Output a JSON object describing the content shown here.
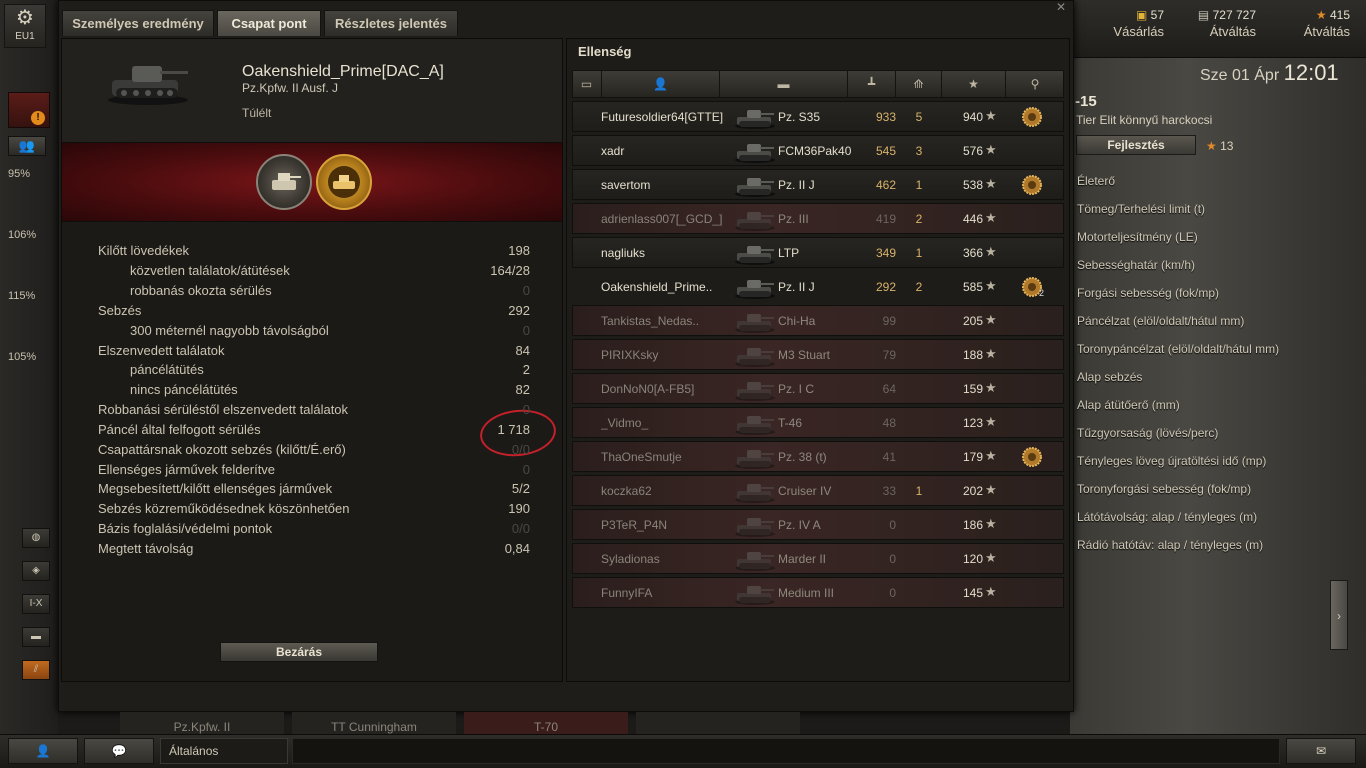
{
  "server": "EU1",
  "currency": [
    {
      "value": "57",
      "label": "Vásárlás"
    },
    {
      "value": "727 727",
      "label": "Átváltás"
    },
    {
      "value": "415",
      "label": "Átváltás"
    }
  ],
  "datetime": {
    "date": "Sze 01 Ápr",
    "time": "12:01"
  },
  "vehicle_panel": {
    "tier_num": "-15",
    "tier_desc": "Tier Elit könnyű harckocsi",
    "upgrade": "Fejlesztés",
    "xp": "13",
    "specs": [
      "Életerő",
      "Tömeg/Terhelési limit (t)",
      "Motorteljesítmény (LE)",
      "Sebességhatár (km/h)",
      "Forgási sebesség (fok/mp)",
      "Páncélzat (elöl/oldalt/hátul mm)",
      "Toronypáncélzat (elöl/oldalt/hátul mm)",
      "Alap sebzés",
      "Alap átütőerő (mm)",
      "Tűzgyorsaság (lövés/perc)",
      "Tényleges löveg újratöltési idő (mp)",
      "Toronyforgási sebesség (fok/mp)",
      "Látótávolság: alap / tényleges (m)",
      "Rádió hatótáv: alap / tényleges (m)"
    ]
  },
  "left_strip": {
    "percents": [
      "95%",
      "106%",
      "115%",
      "105%"
    ],
    "tier_btn": "I-X"
  },
  "tabs": [
    "Személyes eredmény",
    "Csapat pont",
    "Részletes jelentés"
  ],
  "player": {
    "name": "Oakenshield_Prime[DAC_A]",
    "vehicle": "Pz.Kpfw. II Ausf. J",
    "status": "Túlélt"
  },
  "stats": [
    {
      "label": "Kilőtt lövedékek",
      "value": "198",
      "indent": false,
      "dim": false
    },
    {
      "label": "közvetlen találatok/átütések",
      "value": "164/28",
      "indent": true,
      "dim": false
    },
    {
      "label": "robbanás okozta sérülés",
      "value": "0",
      "indent": true,
      "dim": true
    },
    {
      "label": "Sebzés",
      "value": "292",
      "indent": false,
      "dim": false
    },
    {
      "label": "300 méternél nagyobb távolságból",
      "value": "0",
      "indent": true,
      "dim": true
    },
    {
      "label": "Elszenvedett találatok",
      "value": "84",
      "indent": false,
      "dim": false
    },
    {
      "label": "páncélátütés",
      "value": "2",
      "indent": true,
      "dim": false
    },
    {
      "label": "nincs páncélátütés",
      "value": "82",
      "indent": true,
      "dim": false
    },
    {
      "label": "Robbanási sérüléstől elszenvedett találatok",
      "value": "0",
      "indent": false,
      "dim": true
    },
    {
      "label": "Páncél által felfogott sérülés",
      "value": "1 718",
      "indent": false,
      "dim": false
    },
    {
      "label": "Csapattársnak okozott sebzés (kilőtt/É.erő)",
      "value": "0/0",
      "indent": false,
      "dim": true
    },
    {
      "label": "Ellenséges járművek felderítve",
      "value": "0",
      "indent": false,
      "dim": true
    },
    {
      "label": "Megsebesített/kilőtt ellenséges járművek",
      "value": "5/2",
      "indent": false,
      "dim": false
    },
    {
      "label": "Sebzés közreműködésednek köszönhetően",
      "value": "190",
      "indent": false,
      "dim": false
    },
    {
      "label": "Bázis foglalási/védelmi pontok",
      "value": "0/0",
      "indent": false,
      "dim": true
    },
    {
      "label": "Megtett távolság",
      "value": "0,84",
      "indent": false,
      "dim": false
    }
  ],
  "close_btn": "Bezárás",
  "enemy_title": "Ellenség",
  "enemies": [
    {
      "name": "Futuresoldier64[GTTE]",
      "vehicle": "Pz. S35",
      "damage": "933",
      "kills": "5",
      "xp": "940",
      "dead": false,
      "ach": true,
      "me": false
    },
    {
      "name": "xadr",
      "vehicle": "FCM36Pak40",
      "damage": "545",
      "kills": "3",
      "xp": "576",
      "dead": false,
      "ach": false,
      "me": false
    },
    {
      "name": "savertom",
      "vehicle": "Pz. II J",
      "damage": "462",
      "kills": "1",
      "xp": "538",
      "dead": false,
      "ach": true,
      "me": false
    },
    {
      "name": "adrienlass007[_GCD_]",
      "vehicle": "Pz. III",
      "damage": "419",
      "kills": "2",
      "xp": "446",
      "dead": true,
      "ach": false,
      "me": false
    },
    {
      "name": "nagliuks",
      "vehicle": "LTP",
      "damage": "349",
      "kills": "1",
      "xp": "366",
      "dead": false,
      "ach": false,
      "me": false
    },
    {
      "name": "Oakenshield_Prime..",
      "vehicle": "Pz. II J",
      "damage": "292",
      "kills": "2",
      "xp": "585",
      "dead": false,
      "ach": true,
      "ach_count": "2",
      "me": true
    },
    {
      "name": "Tankistas_Nedas..",
      "vehicle": "Chi-Ha",
      "damage": "99",
      "kills": "",
      "xp": "205",
      "dead": true,
      "ach": false,
      "me": false
    },
    {
      "name": "PIRIXKsky",
      "vehicle": "M3 Stuart",
      "damage": "79",
      "kills": "",
      "xp": "188",
      "dead": true,
      "ach": false,
      "me": false
    },
    {
      "name": "DonNoN0[A-FB5]",
      "vehicle": "Pz. I C",
      "damage": "64",
      "kills": "",
      "xp": "159",
      "dead": true,
      "ach": false,
      "me": false
    },
    {
      "name": "_Vidmo_",
      "vehicle": "T-46",
      "damage": "48",
      "kills": "",
      "xp": "123",
      "dead": true,
      "ach": false,
      "me": false
    },
    {
      "name": "ThaOneSmutje",
      "vehicle": "Pz. 38 (t)",
      "damage": "41",
      "kills": "",
      "xp": "179",
      "dead": true,
      "ach": true,
      "me": false
    },
    {
      "name": "koczka62",
      "vehicle": "Cruiser IV",
      "damage": "33",
      "kills": "1",
      "xp": "202",
      "dead": true,
      "ach": false,
      "me": false
    },
    {
      "name": "P3TeR_P4N",
      "vehicle": "Pz. IV A",
      "damage": "0",
      "kills": "",
      "xp": "186",
      "dead": true,
      "ach": false,
      "me": false
    },
    {
      "name": "Syladionas",
      "vehicle": "Marder II",
      "damage": "0",
      "kills": "",
      "xp": "120",
      "dead": true,
      "ach": false,
      "me": false
    },
    {
      "name": "FunnyIFA",
      "vehicle": "Medium III",
      "damage": "0",
      "kills": "",
      "xp": "145",
      "dead": true,
      "ach": false,
      "me": false
    }
  ],
  "under_bar": [
    "Pz.Kpfw. II",
    "TT Cunningham",
    "T-70"
  ],
  "chat_channel": "Általános",
  "colors": {
    "accent_gold": "#d8b26a",
    "medal_red": "#7a1518",
    "annotation_red": "#c4202a"
  }
}
